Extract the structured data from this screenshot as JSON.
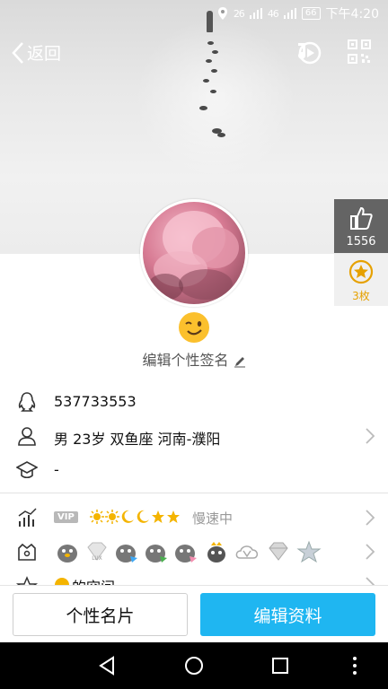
{
  "status_bar": {
    "net1": "26",
    "net2": "46",
    "battery": "66",
    "time": "下午4:20"
  },
  "nav": {
    "back_label": "返回"
  },
  "likes": {
    "count": "1556"
  },
  "medal": {
    "count": "3枚"
  },
  "signature": {
    "text": "编辑个性签名"
  },
  "profile": {
    "qq": "537733553",
    "details": "男  23岁  双鱼座  河南-濮阳",
    "school": "-",
    "vip_label": "VIP",
    "level_icons": [
      "sun",
      "sun",
      "moon",
      "moon",
      "star",
      "star"
    ],
    "speed_status": "慢速中",
    "partial_row": "的空间"
  },
  "buttons": {
    "card": "个性名片",
    "edit": "编辑资料"
  },
  "colors": {
    "accent": "#1fb6f1",
    "medal": "#e6a100"
  }
}
